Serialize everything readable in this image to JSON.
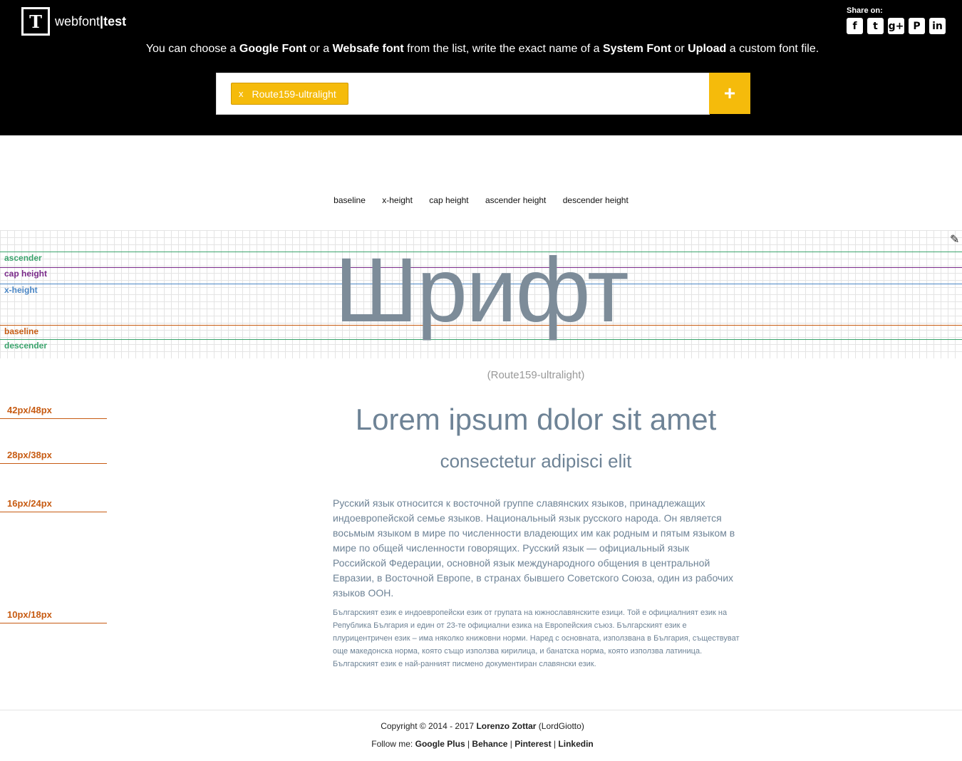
{
  "header": {
    "logo_letter": "T",
    "logo_name": "webfont",
    "logo_sep": "|",
    "logo_suffix": "test",
    "share_title": "Share on:",
    "share_icons": [
      "facebook-icon",
      "twitter-icon",
      "google-plus-icon",
      "pinterest-icon",
      "linkedin-icon"
    ],
    "intro": {
      "t1": "You can choose a ",
      "b1": "Google Font",
      "t2": " or a ",
      "b2": "Websafe font",
      "t3": " from the list, write the exact name of a ",
      "b3": "System Font",
      "t4": " or ",
      "b4": "Upload",
      "t5": " a custom font file."
    },
    "tag_remove": "x",
    "tag_label": "Route159-ultralight",
    "add_button": "+"
  },
  "toggles": [
    "baseline",
    "x-height",
    "cap height",
    "ascender height",
    "descender height"
  ],
  "metrics": {
    "ascender": "ascender",
    "cap_height": "cap height",
    "x_height": "x-height",
    "baseline": "baseline",
    "descender": "descender"
  },
  "specimen": {
    "text": "Шрифт",
    "font_name": "(Route159-ultralight)"
  },
  "sizes": {
    "s42": "42px/48px",
    "s28": "28px/38px",
    "s16": "16px/24px",
    "s10": "10px/18px"
  },
  "samples": {
    "title": "Lorem ipsum dolor sit amet",
    "subtitle": "consectetur adipisci elit",
    "paragraph_ru": "Русский язык относится к восточной группе славянских языков, принадлежащих индоевропейской семье языков. Национальный язык русского народа. Он является восьмым языком в мире по численности владеющих им как родным и пятым языком в мире по общей численности говорящих. Русский язык — официальный язык Российской Федерации, основной язык международного общения в центральной Евразии, в Восточной Европе, в странах бывшего Советского Союза, один из рабочих языков ООН.",
    "paragraph_bg": "Българският език е индоевропейски език от групата на южнославянските езици. Той е официалният език на Република България и един от 23-те официални езика на Европейския съюз. Българският език е плурицентричен език – има няколко книжовни норми. Наред с основната, използвана в България, съществуват още македонска норма, която също използва кирилица, и банатска норма, която използва латиница. Българският език е най-ранният писмено документиран славянски език."
  },
  "footer": {
    "copyright": "Copyright © 2014 - 2017 ",
    "author": "Lorenzo Zottar",
    "nick": " (LordGiotto)",
    "follow": "Follow me: ",
    "links": [
      "Google Plus",
      "Behance",
      "Pinterest",
      "Linkedin"
    ],
    "sep": " | "
  },
  "colors": {
    "accent": "#f5bb0b",
    "ascender": "#3aa36c",
    "cap_height": "#7a2a8a",
    "x_height": "#4a86c5",
    "baseline": "#c75b12",
    "descender": "#3aa36c",
    "sample_text": "#6e8396"
  }
}
